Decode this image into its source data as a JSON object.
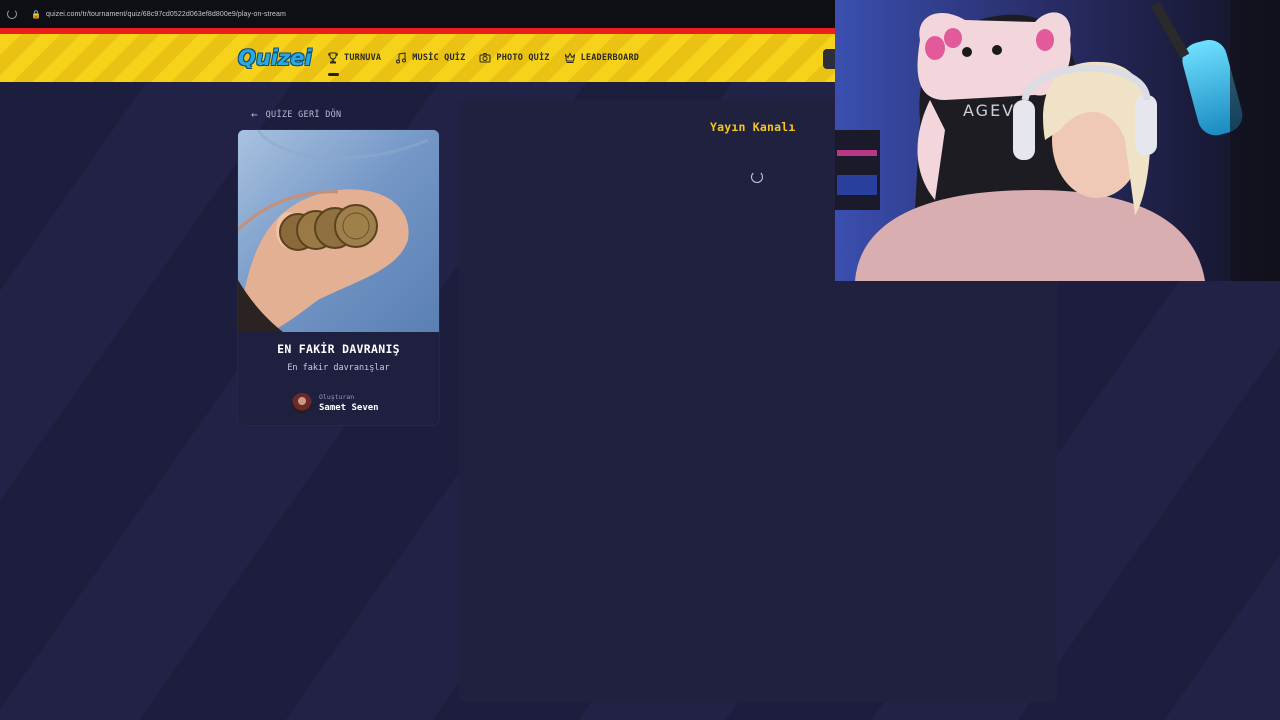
{
  "browser": {
    "url": "quizei.com/tr/tournament/quiz/68c97cd0522d063ef8d800e9/play-on-stream"
  },
  "header": {
    "logo": "Quizei",
    "nav": [
      {
        "label": "TURNUVA",
        "icon": "trophy-icon",
        "active": true
      },
      {
        "label": "MUSİC QUİZ",
        "icon": "music-note-icon",
        "active": false
      },
      {
        "label": "PHOTO QUİZ",
        "icon": "camera-icon",
        "active": false
      },
      {
        "label": "LEADERBOARD",
        "icon": "crown-icon",
        "active": false
      }
    ]
  },
  "back": {
    "label": "QUİZE GERİ DÖN"
  },
  "quiz": {
    "title": "EN FAKİR DAVRANIŞ",
    "subtitle": "En fakir davranışlar",
    "creator_label": "Oluşturan",
    "creator_name": "Samet Seven"
  },
  "panel": {
    "title": "Yayın Kanalı"
  },
  "colors": {
    "background": "#1c1c3c",
    "header_yellow": "#f6d21a",
    "accent_yellow": "#f3c623",
    "logo_blue": "#2aa8e0",
    "red_strip": "#e8201f"
  }
}
